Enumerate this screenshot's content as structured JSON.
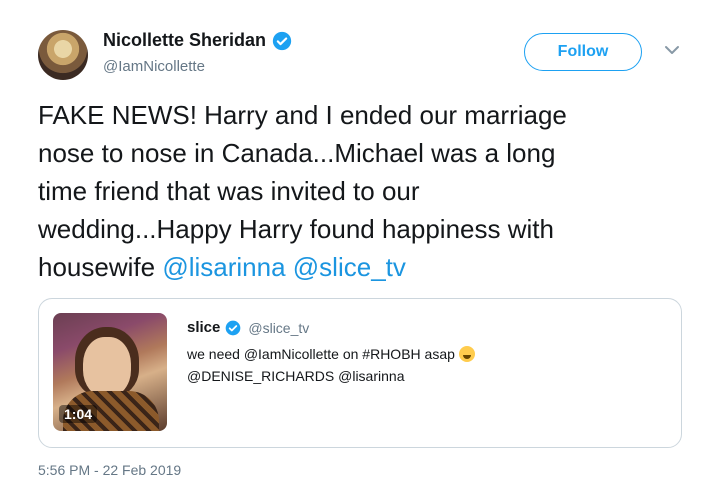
{
  "author": {
    "name": "Nicollette Sheridan",
    "handle": "@IamNicollette"
  },
  "follow_label": "Follow",
  "tweet": {
    "text_lines": [
      "FAKE NEWS! Harry and I ended our marriage",
      "nose to nose in Canada...Michael was a long",
      "time friend that was invited to our",
      "wedding...Happy Harry found happiness with"
    ],
    "last_line_prefix": "housewife ",
    "mention_1": "@lisarinna",
    "mention_2": "@slice_tv"
  },
  "quoted": {
    "name": "slice",
    "handle": "@slice_tv",
    "line1": "we need @IamNicollette on #RHOBH asap",
    "line2": "@DENISE_RICHARDS @lisarinna",
    "video_duration": "1:04"
  },
  "timestamp": "5:56 PM - 22 Feb 2019",
  "colors": {
    "accent": "#1da1f2",
    "mention": "#1b95e0",
    "muted": "#657786",
    "border": "#ccd6dd"
  }
}
